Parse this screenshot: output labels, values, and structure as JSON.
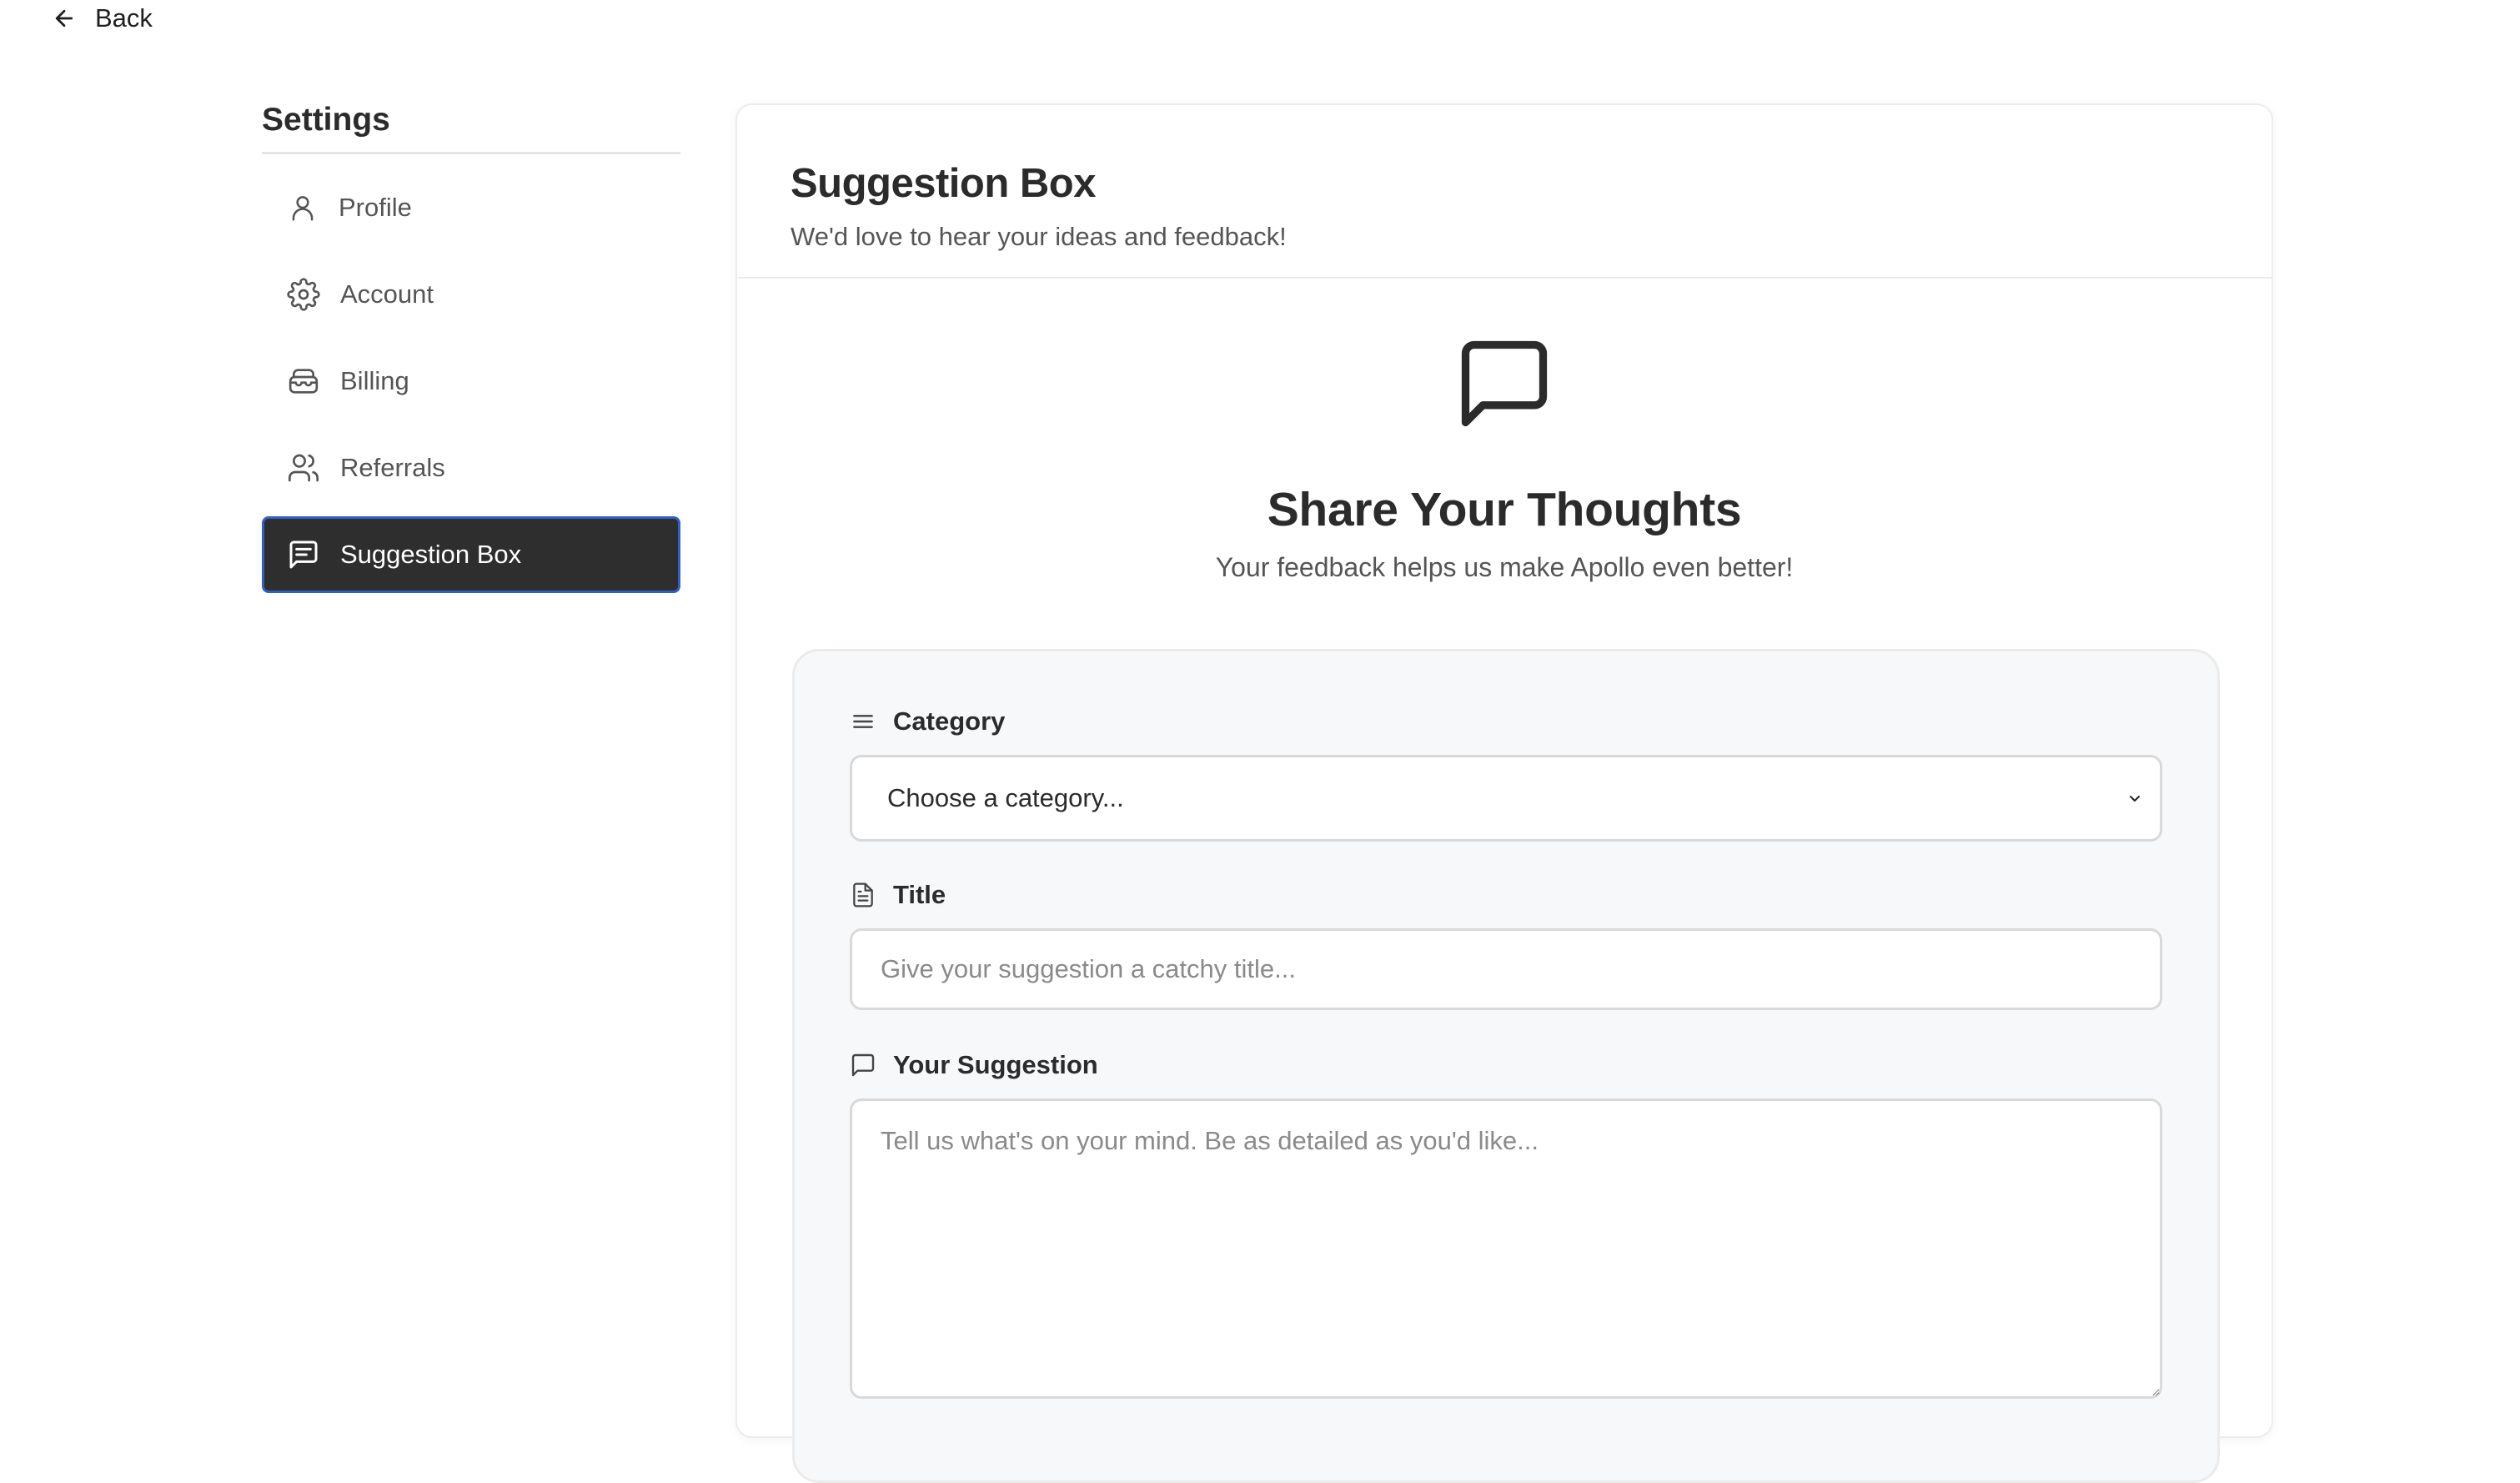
{
  "back_label": "Back",
  "sidebar": {
    "title": "Settings",
    "items": [
      {
        "label": "Profile",
        "icon": "user-icon",
        "active": false
      },
      {
        "label": "Account",
        "icon": "gear-icon",
        "active": false
      },
      {
        "label": "Billing",
        "icon": "wallet-icon",
        "active": false
      },
      {
        "label": "Referrals",
        "icon": "users-icon",
        "active": false
      },
      {
        "label": "Suggestion Box",
        "icon": "message-square-text-icon",
        "active": true
      }
    ]
  },
  "card": {
    "title": "Suggestion Box",
    "subtitle": "We'd love to hear your ideas and feedback!"
  },
  "hero": {
    "icon": "message-square-icon",
    "title": "Share Your Thoughts",
    "subtitle": "Your feedback helps us make Apollo even better!"
  },
  "form": {
    "category": {
      "label": "Category",
      "icon": "menu-icon",
      "value": "Choose a category..."
    },
    "title": {
      "label": "Title",
      "icon": "file-text-icon",
      "placeholder": "Give your suggestion a catchy title..."
    },
    "suggestion": {
      "label": "Your Suggestion",
      "icon": "message-square-icon",
      "placeholder": "Tell us what's on your mind. Be as detailed as you'd like..."
    }
  },
  "colors": {
    "active_bg": "#2e2e2e",
    "active_border": "#2f5fc9",
    "panel_bg": "#f7f8f9"
  }
}
